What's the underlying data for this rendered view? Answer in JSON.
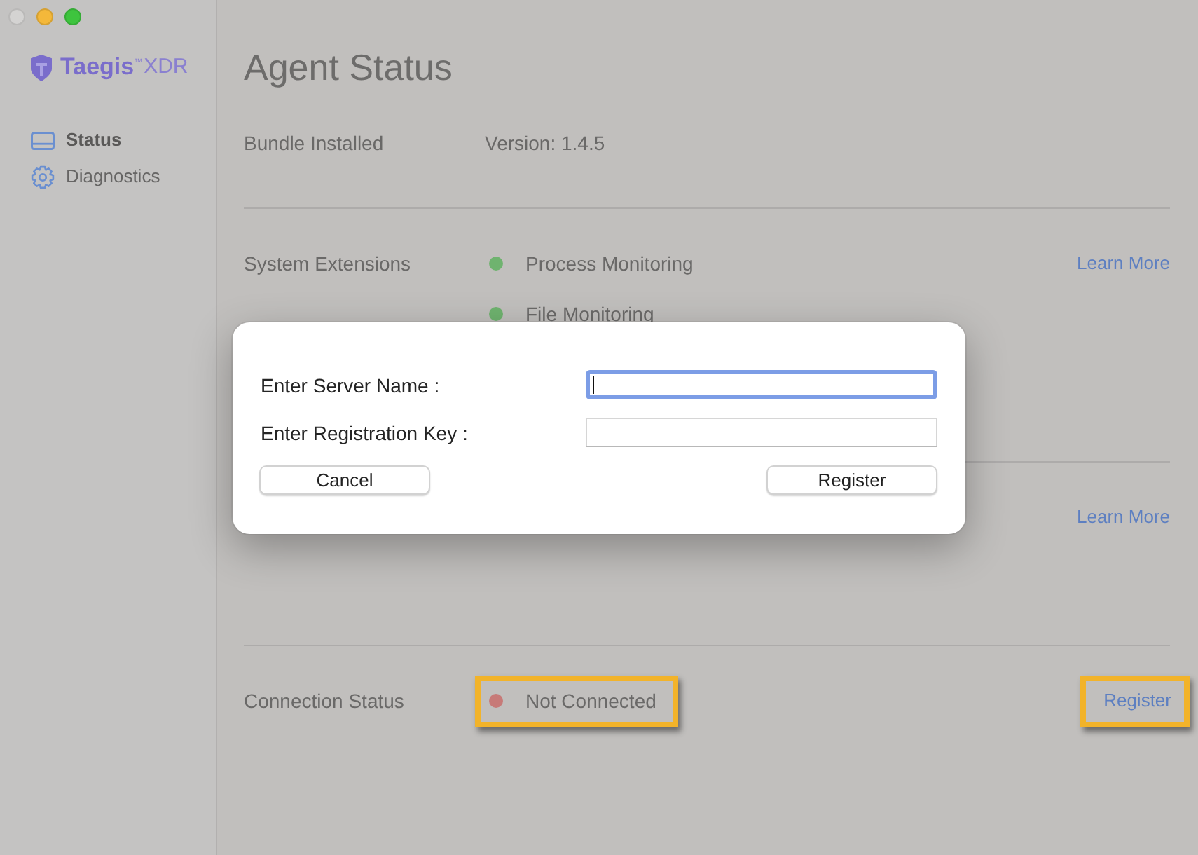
{
  "window": {
    "controls": [
      {
        "kind": "close",
        "disabled": true
      },
      {
        "kind": "minimize",
        "disabled": false
      },
      {
        "kind": "zoom",
        "disabled": false
      }
    ]
  },
  "sidebar": {
    "logo": {
      "name": "Taegis",
      "mark": "™",
      "product": "XDR"
    },
    "items": [
      {
        "label": "Status",
        "selected": true
      },
      {
        "label": "Diagnostics",
        "selected": false
      }
    ]
  },
  "main": {
    "title": "Agent Status",
    "sections": [
      {
        "label": "Bundle Installed",
        "items": [
          {
            "text": "Version: 1.4.5",
            "highlighted": false
          }
        ]
      },
      {
        "label": "System Extensions",
        "items": [
          {
            "text": "Process Monitoring",
            "color": "#6fb36f",
            "highlighted": false
          },
          {
            "text": "File Monitoring",
            "color": "#6fb36f",
            "highlighted": false
          }
        ],
        "link": {
          "text": "Learn More",
          "highlighted": false
        }
      },
      {
        "link": {
          "text": "Learn More",
          "highlighted": false
        }
      },
      {
        "label": "Connection Status",
        "items": [
          {
            "text": "Not Connected",
            "color": "#c77a78",
            "highlighted": true
          }
        ],
        "link": {
          "text": "Register",
          "highlighted": true
        }
      }
    ]
  },
  "dialog": {
    "fields": [
      {
        "label": "Enter Server Name :",
        "focused": true
      },
      {
        "label": "Enter Registration Key :",
        "focused": false
      }
    ],
    "buttons": [
      "Cancel",
      "Register"
    ]
  }
}
